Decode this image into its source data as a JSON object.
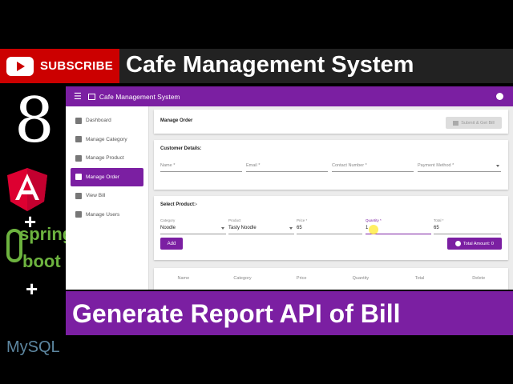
{
  "banner": {
    "subscribe": "SUBSCRIBE",
    "series_title": "Cafe Management System",
    "episode_number": "8",
    "episode_title": "Generate Report API of Bill",
    "tech": [
      "Angular",
      "spring boot",
      "MySQL"
    ],
    "spring": "spring",
    "boot": "boot",
    "mysql": "MySQL",
    "plus": "+"
  },
  "app": {
    "title": "Cafe Management System",
    "accent": "#7b1fa2",
    "nav": [
      {
        "label": "Dashboard",
        "icon": "dashboard-icon"
      },
      {
        "label": "Manage Category",
        "icon": "category-icon"
      },
      {
        "label": "Manage Product",
        "icon": "inventory-icon"
      },
      {
        "label": "Manage Order",
        "icon": "cart-icon",
        "active": true
      },
      {
        "label": "View Bill",
        "icon": "bill-icon"
      },
      {
        "label": "Manage Users",
        "icon": "people-icon"
      }
    ],
    "page_title": "Manage Order",
    "submit_button": "Submit & Get Bill",
    "customer": {
      "title": "Customer Details:",
      "name": "Name *",
      "email": "Email *",
      "contact": "Contact Number *",
      "payment": "Payment Method *"
    },
    "product": {
      "title": "Select Product:-",
      "category_label": "Category",
      "category_value": "Noodle",
      "product_label": "Product",
      "product_value": "Tasty Noodle",
      "price_label": "Price *",
      "price_value": "65",
      "quantity_label": "Quantity *",
      "quantity_value": "1",
      "total_label": "Total *",
      "total_value": "65",
      "add_button": "Add",
      "total_amount": "Total Amount: 0"
    },
    "table_headers": [
      "Name",
      "Category",
      "Price",
      "Quantity",
      "Total",
      "Delete"
    ]
  }
}
